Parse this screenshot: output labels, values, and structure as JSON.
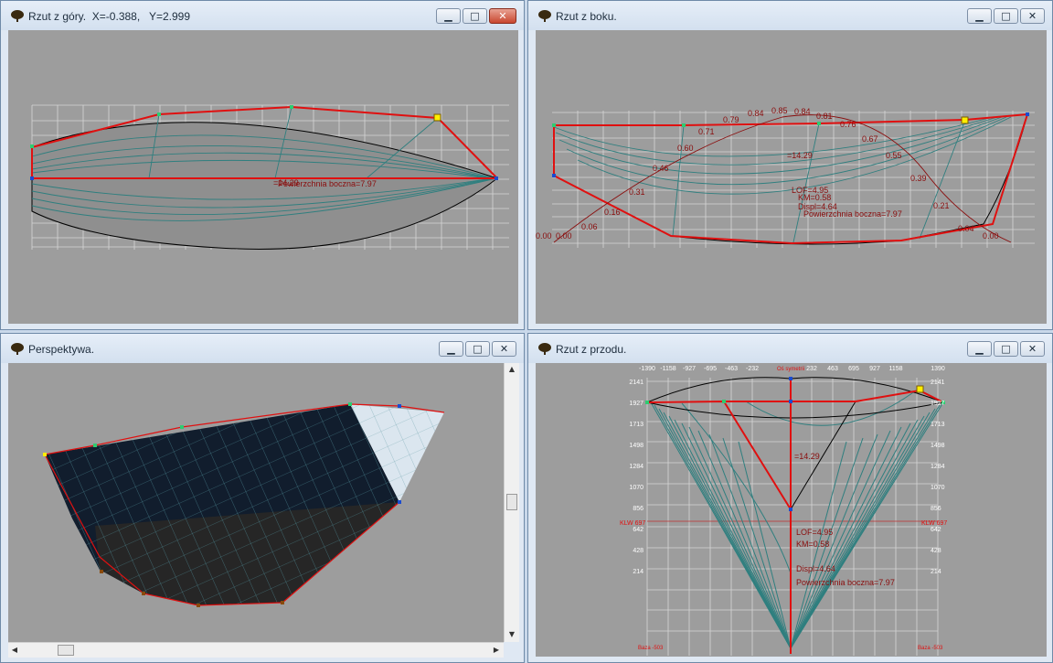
{
  "windows": {
    "top": {
      "title": "Rzut z góry.  X=-0.388,   Y=2.999"
    },
    "side": {
      "title": "Rzut z boku."
    },
    "persp": {
      "title": "Perspektywa."
    },
    "front": {
      "title": "Rzut z przodu."
    }
  },
  "controls": {
    "minimize": "▁",
    "maximize": "□",
    "close": "✕",
    "up": "▲",
    "down": "▼",
    "left": "◀",
    "right": "▶"
  },
  "top_view": {
    "label": "Powierzchnia boczna=7.97",
    "overlap": "=14.29"
  },
  "side_view": {
    "markers": [
      "0.00",
      "0.00",
      "0.06",
      "0.16",
      "0.31",
      "0.46",
      "0.60",
      "0.71",
      "0.79",
      "0.84",
      "0.85",
      "0.84",
      "0.81",
      "0.76",
      "0.67",
      "0.55",
      "0.39",
      "0.21",
      "0.04",
      "0.00"
    ],
    "center_value": "=14.29",
    "lof": "LOF=4.95",
    "km": "KM=0.58",
    "displ": "Displ=4.64",
    "area": "Powierzchnia boczna=7.97"
  },
  "front_view": {
    "symmetry": "Oś symetrii",
    "x_ticks": [
      "-1390",
      "-1158",
      "-927",
      "-695",
      "-463",
      "-232",
      "232",
      "463",
      "695",
      "927",
      "1158",
      "1390"
    ],
    "y_ticks": [
      "2141",
      "1927",
      "1713",
      "1498",
      "1284",
      "1070",
      "856",
      "642",
      "428",
      "214"
    ],
    "klw_left": "KLW 697",
    "klw_right": "KLW 697",
    "baza_left": "Baza -503",
    "baza_right": "Baza -503",
    "center_value": "=14.29",
    "lof": "LOF=4.95",
    "km": "KM=0.58",
    "displ": "Displ=4.64",
    "area": "Powierzchnia boczna=7.97"
  },
  "colors": {
    "canvas": "#9d9d9d",
    "hull_red": "#e01010",
    "hull_lines": "#2f7f7f",
    "dark_hull": "#0e1a2a",
    "titlebar": "#dfe8f3"
  }
}
